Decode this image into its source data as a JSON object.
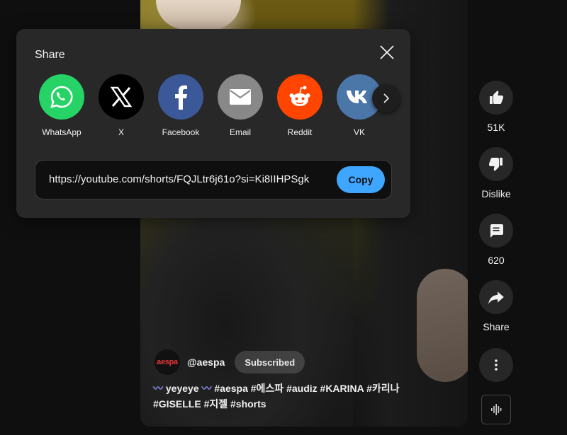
{
  "share_dialog": {
    "title": "Share",
    "targets": [
      {
        "label": "WhatsApp",
        "icon": "whatsapp-icon",
        "color": "#25d366"
      },
      {
        "label": "X",
        "icon": "x-icon",
        "color": "#000000"
      },
      {
        "label": "Facebook",
        "icon": "facebook-icon",
        "color": "#3b5998"
      },
      {
        "label": "Email",
        "icon": "email-icon",
        "color": "#888888"
      },
      {
        "label": "Reddit",
        "icon": "reddit-icon",
        "color": "#ff4500"
      },
      {
        "label": "VK",
        "icon": "vk-icon",
        "color": "#4a76a8"
      }
    ],
    "url": "https://youtube.com/shorts/FQJLtr6j61o?si=Ki8IIHPSgk",
    "copy_label": "Copy"
  },
  "video": {
    "channel_avatar_text": "aespa",
    "channel_handle": "@aespa",
    "subscribe_label": "Subscribed",
    "description_line1_wave": "〰",
    "description_line1_text": " yeyeye ",
    "description_line1_wave2": "〰",
    "description_line1_tags": " #aespa #에스파 #audiz #KARINA #카리나",
    "description_line2": "#GISELLE #지젤 #shorts"
  },
  "actions": {
    "like_count": "51K",
    "dislike_label": "Dislike",
    "comment_count": "620",
    "share_label": "Share"
  },
  "colors": {
    "accent": "#3ea6ff",
    "dialog_bg": "#282828",
    "page_bg": "#0f0f0f"
  }
}
